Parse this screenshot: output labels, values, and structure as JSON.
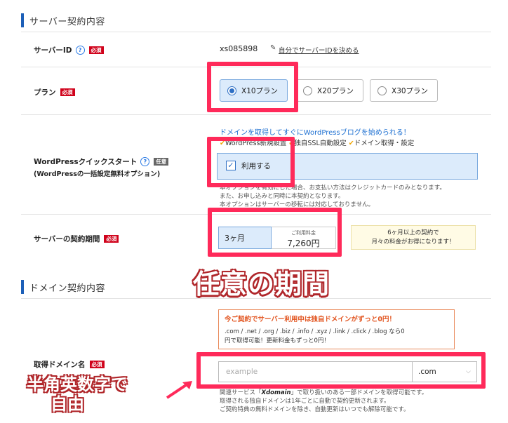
{
  "section_server": {
    "title": "サーバー契約内容"
  },
  "server_id": {
    "label": "サーバーID",
    "badge": "必須",
    "value": "xs085898",
    "link": "自分でサーバーIDを決める"
  },
  "plan": {
    "label": "プラン",
    "badge": "必須",
    "options": [
      "X10プラン",
      "X20プラン",
      "X30プラン"
    ],
    "selected": "X10プラン"
  },
  "wordpress": {
    "label": "WordPressクイックスタート",
    "sublabel": "(WordPressの一括設定無料オプション)",
    "badge": "任意",
    "promo": "ドメインを取得してすぐにWordPressブログを始められる！",
    "features": [
      "WordPress新規設置",
      "独自SSL自動設定",
      "ドメイン取得・設定"
    ],
    "checkbox_label": "利用する",
    "checked": true,
    "note": [
      "本オプションを有効にした場合、お支払い方法はクレジットカードのみとなります。",
      "また、お申し込みと同時に本契約となります。",
      "本オプションはサーバーの移転には対応しておりません。"
    ]
  },
  "period": {
    "label": "サーバーの契約期間",
    "badge": "必須",
    "value": "3ヶ月",
    "fee_label": "ご利用料金",
    "fee": "7,260円",
    "hint": [
      "6ヶ月以上の契約で",
      "月々の料金がお得になります！"
    ]
  },
  "annotation_period": "任意の期間",
  "section_domain": {
    "title": "ドメイン契約内容"
  },
  "domain_promo": {
    "heading": "今ご契約でサーバー利用中は独自ドメインがずっと0円！",
    "body": [
      ".com / .net / .org / .biz / .info / .xyz / .link / .click / .blog なら0",
      "円で取得可能！更新料金もずっと0円！"
    ]
  },
  "domain": {
    "label": "取得ドメイン名",
    "badge": "必須",
    "placeholder": "example",
    "tld": ".com",
    "note_prefix": "関連サービス「",
    "note_brand": "Xdomain",
    "note_suffix": "」で取り扱いのある一部ドメインを取得可能です。",
    "note": [
      "取得される独自ドメインは1年ごとに自動で契約更新されます。",
      "ご契約特典の無料ドメインを除き、自動更新はいつでも解除可能です。"
    ]
  },
  "annotation_domain": [
    "半角英数字で",
    "自由"
  ],
  "colors": {
    "accent": "#1c5fb8",
    "highlight": "#ff2a5a",
    "required": "#d0021b"
  }
}
